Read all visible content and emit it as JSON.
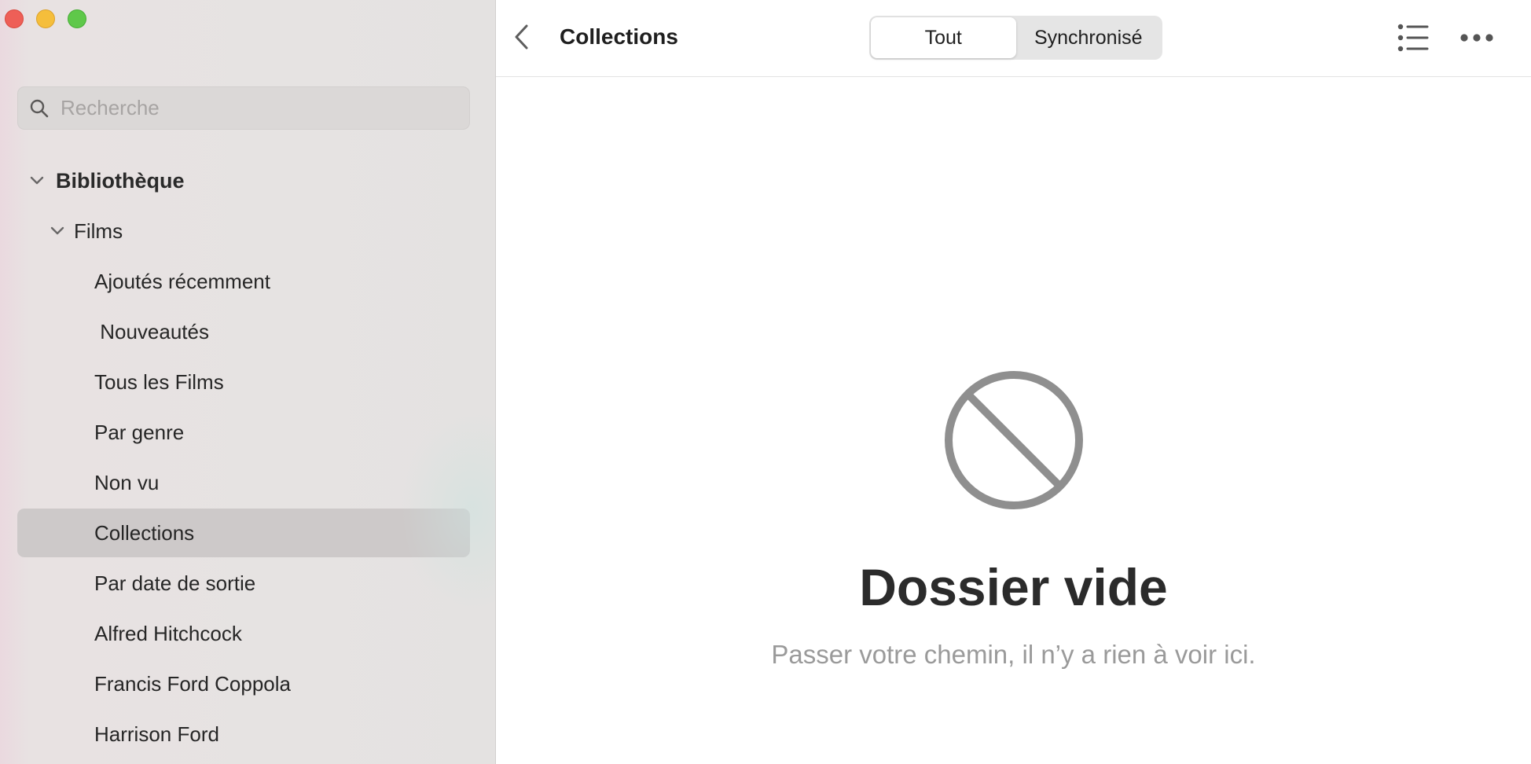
{
  "window": {
    "controls": [
      "close",
      "minimize",
      "maximize"
    ]
  },
  "sidebar": {
    "search": {
      "placeholder": "Recherche",
      "value": ""
    },
    "library": {
      "label": "Bibliothèque",
      "expanded": true
    },
    "films": {
      "label": "Films",
      "expanded": true
    },
    "items": [
      {
        "label": "Ajoutés récemment",
        "selected": false
      },
      {
        "label": " Nouveautés",
        "selected": false
      },
      {
        "label": "Tous les Films",
        "selected": false
      },
      {
        "label": "Par genre",
        "selected": false
      },
      {
        "label": "Non vu",
        "selected": false
      },
      {
        "label": "Collections",
        "selected": true
      },
      {
        "label": "Par date de sortie",
        "selected": false
      },
      {
        "label": "Alfred Hitchcock",
        "selected": false
      },
      {
        "label": "Francis Ford Coppola",
        "selected": false
      },
      {
        "label": "Harrison Ford",
        "selected": false
      }
    ]
  },
  "toolbar": {
    "title": "Collections",
    "segments": [
      {
        "label": "Tout",
        "active": true
      },
      {
        "label": "Synchronisé",
        "active": false
      }
    ],
    "icons": [
      "chevron-left-icon",
      "list-view-icon",
      "more-icon"
    ]
  },
  "empty_state": {
    "icon": "prohibited-icon",
    "title": "Dossier vide",
    "subtitle": "Passer votre chemin, il n’y a rien à voir ici."
  },
  "colors": {
    "close": "#ee5f57",
    "minimize": "#f5be3b",
    "maximize": "#5fc84a",
    "selected_row": "#cdc9c9",
    "empty_icon": "#8f8f8f"
  }
}
